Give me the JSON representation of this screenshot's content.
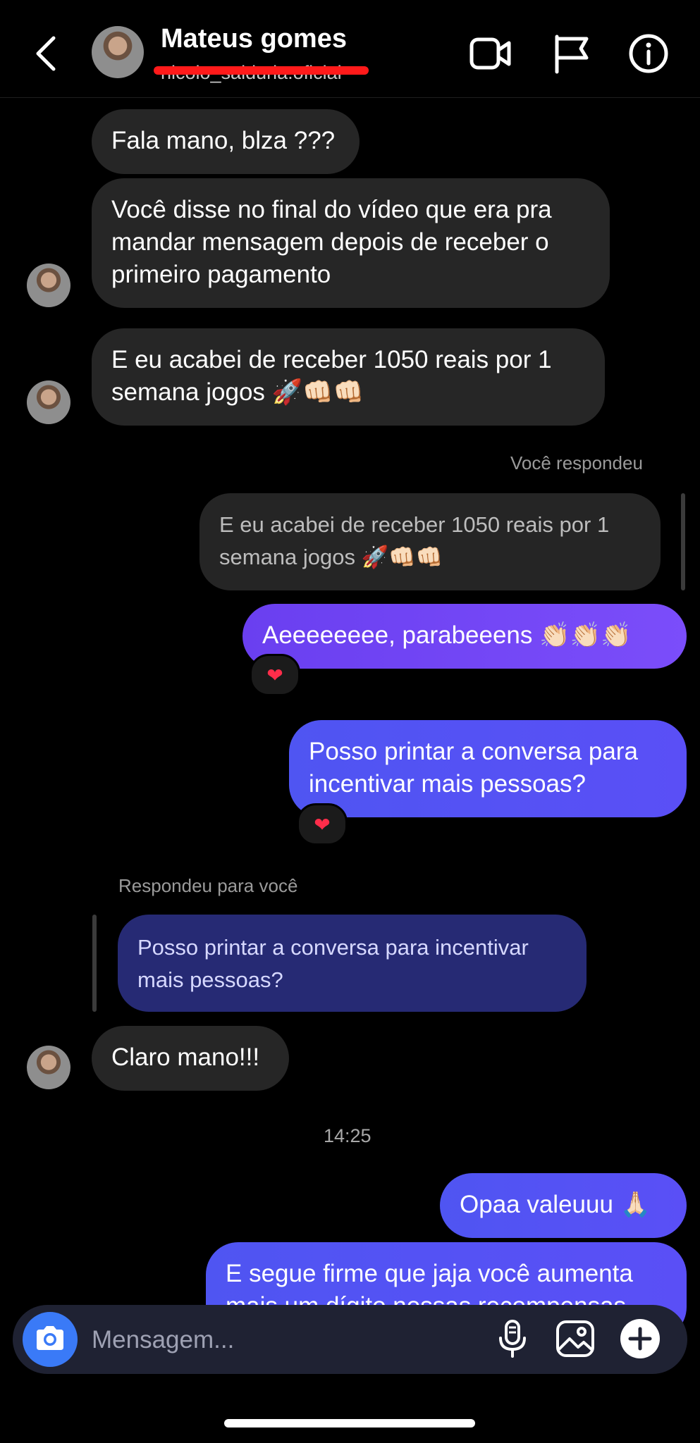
{
  "header": {
    "name": "Mateus gomes",
    "username": "nicolo_salduria.oficial"
  },
  "messages": {
    "m1": "Fala mano, blza ???",
    "m2": "Você disse no final do vídeo que era pra mandar mensagem depois de receber o primeiro pagamento",
    "m3": "E eu acabei de receber 1050 reais por 1 semana jogos 🚀👊🏻👊🏻",
    "reply_label_1": "Você respondeu",
    "quote_1": "E eu acabei de receber 1050 reais por 1 semana jogos 🚀👊🏻👊🏻",
    "m4": "Aeeeeeeee, parabeeens 👏🏻👏🏻👏🏻",
    "m4_reaction": "❤",
    "m5": "Posso printar a conversa para incentivar mais pessoas?",
    "m5_reaction": "❤",
    "reply_label_2": "Respondeu para você",
    "quote_2": "Posso printar a conversa para incentivar mais pessoas?",
    "m6": "Claro mano!!!",
    "timestamp": "14:25",
    "m7": "Opaa valeuuu 🙏🏻",
    "m8": "E segue firme que jaja você aumenta mais um dígito nossas recompensas"
  },
  "composer": {
    "placeholder": "Mensagem..."
  },
  "colors": {
    "sent_bubble": "#7046f4",
    "sent_bubble_blue": "#5352f3",
    "received_bubble": "#262626",
    "quote_reply": "#262a74",
    "camera_button": "#3a7af7",
    "redaction": "#ff1a1a"
  },
  "icons": [
    "back-arrow-icon",
    "video-call-icon",
    "flag-icon",
    "info-icon",
    "camera-icon",
    "microphone-icon",
    "gallery-icon",
    "plus-icon"
  ]
}
